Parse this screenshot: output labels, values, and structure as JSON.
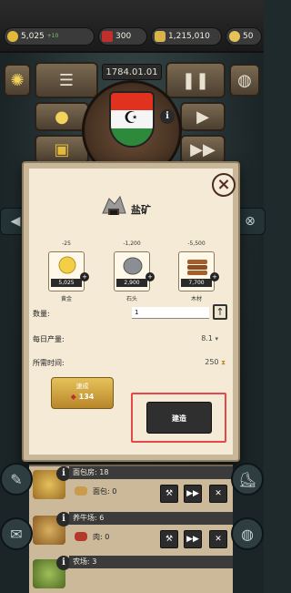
{
  "resources": {
    "gold": {
      "value": "5,025",
      "delta": "+10"
    },
    "gems": {
      "value": "300"
    },
    "money": {
      "value": "1,215,010"
    },
    "stars": {
      "value": "50"
    }
  },
  "top": {
    "date": "1784.01.01"
  },
  "dialog": {
    "title": "盐矿",
    "costs": [
      {
        "need": "-25",
        "have": "5,025",
        "name": "黄金"
      },
      {
        "need": "-1,200",
        "have": "2,900",
        "name": "石头"
      },
      {
        "need": "-5,500",
        "have": "7,700",
        "name": "木材"
      }
    ],
    "quantity_label": "数量:",
    "quantity_value": "1",
    "daily_label": "每日产量:",
    "daily_value": "8.1",
    "time_label": "所需时间:",
    "time_value": "250",
    "rush": {
      "label": "速成",
      "cost": "134"
    },
    "build_label": "建造"
  },
  "list": [
    {
      "title": "面包房: 18",
      "sub": "面包: 0"
    },
    {
      "title": "养牛场: 6",
      "sub": "肉: 0"
    },
    {
      "title": "农场: 3",
      "sub": ""
    }
  ],
  "colors": {
    "accent_red": "#e54848",
    "parchment": "#f4ead6",
    "gold": "#e6c25a"
  }
}
